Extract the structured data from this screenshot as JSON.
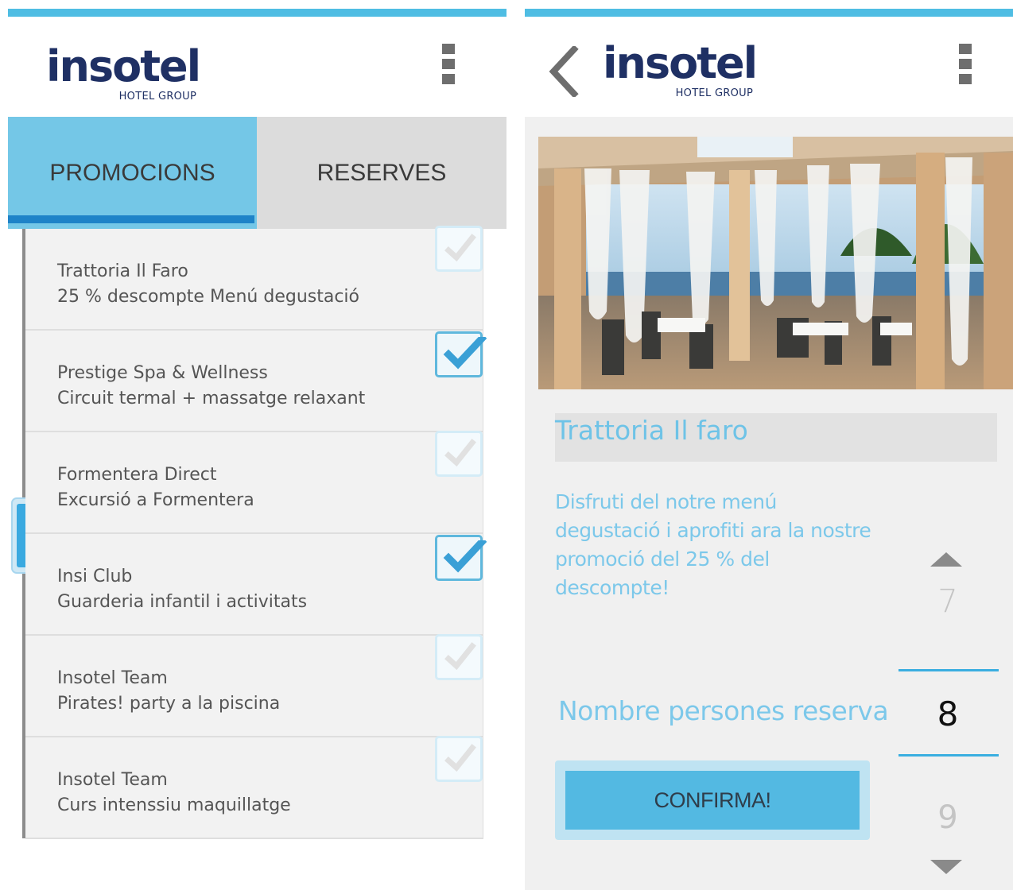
{
  "colors": {
    "accent": "#4fbde3",
    "active_tab": "#74c7e7",
    "tab_indicator": "#1e83c8",
    "brand_navy": "#1f3064",
    "light_text_blue": "#7cc8ea",
    "button": "#53b9e2"
  },
  "brand": {
    "word": "insotel",
    "subtitle": "HOTEL GROUP"
  },
  "left_screen": {
    "tabs": [
      {
        "label": "PROMOCIONS",
        "active": true
      },
      {
        "label": "RESERVES",
        "active": false
      }
    ],
    "promotions": [
      {
        "title": "Trattoria Il Faro",
        "description": "25 % descompte Menú degustació",
        "checked": false
      },
      {
        "title": "Prestige Spa & Wellness",
        "description": "Circuit termal + massatge relaxant",
        "checked": true
      },
      {
        "title": "Formentera Direct",
        "description": "Excursió a Formentera",
        "checked": false
      },
      {
        "title": "Insi Club",
        "description": "Guarderia infantil i activitats",
        "checked": true
      },
      {
        "title": "Insotel Team",
        "description": "Pirates! party a la piscina",
        "checked": false
      },
      {
        "title": "Insotel Team",
        "description": "Curs intenssiu maquillatge",
        "checked": false
      }
    ],
    "icons": {
      "menu": "overflow-menu-icon",
      "checkbox": "checkmark-icon"
    }
  },
  "right_screen": {
    "detail": {
      "title": "Trattoria Il faro",
      "description": "Disfruti del notre menú degustació i aprofiti ara la nostre promoció del 25 % del descompte!"
    },
    "persons": {
      "label": "Nombre persones reserva",
      "previous": "7",
      "current": "8",
      "next": "9"
    },
    "confirm_label": "CONFIRMA!",
    "icons": {
      "back": "chevron-left-icon",
      "menu": "overflow-menu-icon",
      "up": "arrow-up-icon",
      "down": "arrow-down-icon"
    }
  }
}
